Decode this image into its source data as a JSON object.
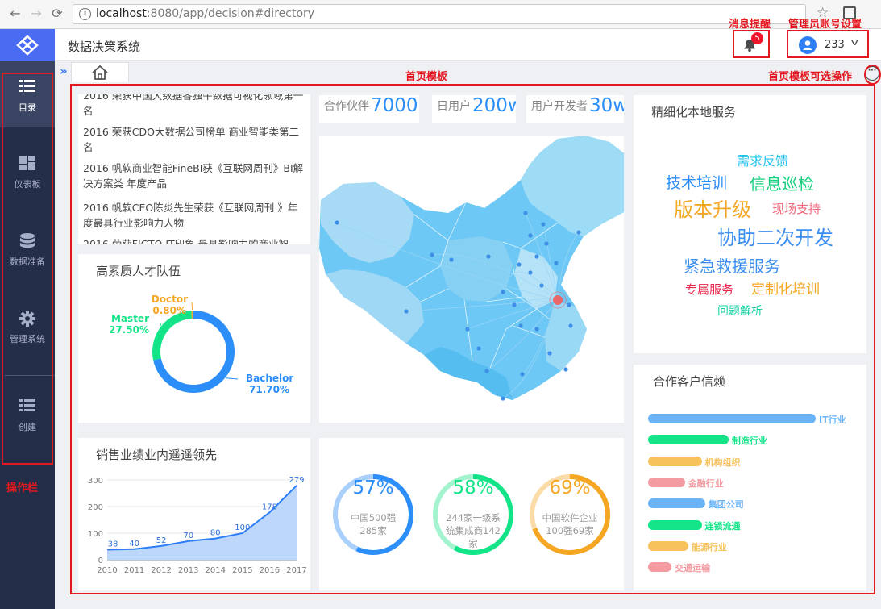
{
  "browser": {
    "url_host": "localhost",
    "url_path": ":8080/app/decision#directory"
  },
  "header": {
    "title": "数据决策系统",
    "notify_count": "5",
    "username": "233"
  },
  "sidebar": {
    "items": [
      {
        "label": "目录",
        "icon": "list-icon"
      },
      {
        "label": "仪表板",
        "icon": "dashboard-icon"
      },
      {
        "label": "数据准备",
        "icon": "database-icon"
      },
      {
        "label": "管理系统",
        "icon": "gear-icon"
      },
      {
        "label": "创建",
        "icon": "list-icon"
      }
    ]
  },
  "annotations": {
    "notify": "消息提醒",
    "admin": "管理员账号设置",
    "home_template": "首页模板",
    "home_ops": "首页模板可选操作",
    "operation_bar": "操作栏"
  },
  "news": [
    "2016 荣获中国大数据各独牛数据可视化领域第一名",
    "2016 荣获CDO大数据公司榜单 商业智能类第二名",
    "2016 帆软商业智能FineBI获《互联网周刊》BI解决方案类 年度产品",
    "2016 帆软CEO陈炎先生荣获《互联网周刊 》年度最具行业影响力人物",
    "2016 荣获FIGTO IT印象 最具影响力的商业智"
  ],
  "stats": [
    {
      "label": "合作伙伴",
      "value": "7000"
    },
    {
      "label": "日用户",
      "value": "200w"
    },
    {
      "label": "用户开发者",
      "value": "30w"
    }
  ],
  "talent": {
    "title": "高素质人才队伍",
    "chart_data": {
      "type": "pie",
      "slices": [
        {
          "name": "Bachelor",
          "value": 71.7,
          "label": "71.70%",
          "color": "#2c8ef8"
        },
        {
          "name": "Master",
          "value": 27.5,
          "label": "27.50%",
          "color": "#14e488"
        },
        {
          "name": "Doctor",
          "value": 0.8,
          "label": "0.80%",
          "color": "#f5a623"
        }
      ]
    }
  },
  "services": {
    "title": "精细化本地服务",
    "words": [
      {
        "text": "需求反馈",
        "color": "#27c3ef"
      },
      {
        "text": "技术培训",
        "color": "#2c8ef8"
      },
      {
        "text": "信息巡检",
        "color": "#14d07c"
      },
      {
        "text": "版本升级",
        "color": "#f5a623"
      },
      {
        "text": "现场支持",
        "color": "#f0677a"
      },
      {
        "text": "协助二次开发",
        "color": "#3b8ff0"
      },
      {
        "text": "紧急救援服务",
        "color": "#3b8ff0"
      },
      {
        "text": "专属服务",
        "color": "#e8254a"
      },
      {
        "text": "定制化培训",
        "color": "#f5a623"
      },
      {
        "text": "问题解析",
        "color": "#14d0a2"
      }
    ]
  },
  "clients": {
    "title": "合作客户信赖",
    "chart_data": {
      "type": "bar",
      "categories": [
        "IT行业",
        "制造行业",
        "机构组织",
        "金融行业",
        "集团公司",
        "连锁流通",
        "能源行业",
        "交通运输"
      ],
      "values": [
        100,
        48,
        32,
        22,
        34,
        32,
        24,
        14
      ],
      "colors": [
        "#6ab3f7",
        "#14e488",
        "#f7c25c",
        "#f49aa1",
        "#6ab3f7",
        "#14e488",
        "#f7c25c",
        "#f49aa1"
      ]
    }
  },
  "sales": {
    "title": "销售业绩业内遥遥领先",
    "chart_data": {
      "type": "area",
      "categories": [
        "2010",
        "2011",
        "2012",
        "2013",
        "2014",
        "2015",
        "2016",
        "2017"
      ],
      "values": [
        38,
        40,
        52,
        70,
        80,
        100,
        178,
        279
      ],
      "ylim": [
        0,
        300
      ],
      "yticks": [
        0,
        100,
        200,
        300
      ]
    }
  },
  "rings": [
    {
      "pct": "57%",
      "value": 57,
      "desc": "中国500强285家",
      "color": "#2c8ef8",
      "light": "#a9cffb"
    },
    {
      "pct": "58%",
      "value": 58,
      "desc": "244家一级系统集成商142家",
      "color": "#14e488",
      "light": "#a4f3cf"
    },
    {
      "pct": "69%",
      "value": 69,
      "desc": "中国软件企业100强69家",
      "color": "#f5a623",
      "light": "#fbdca7"
    }
  ]
}
